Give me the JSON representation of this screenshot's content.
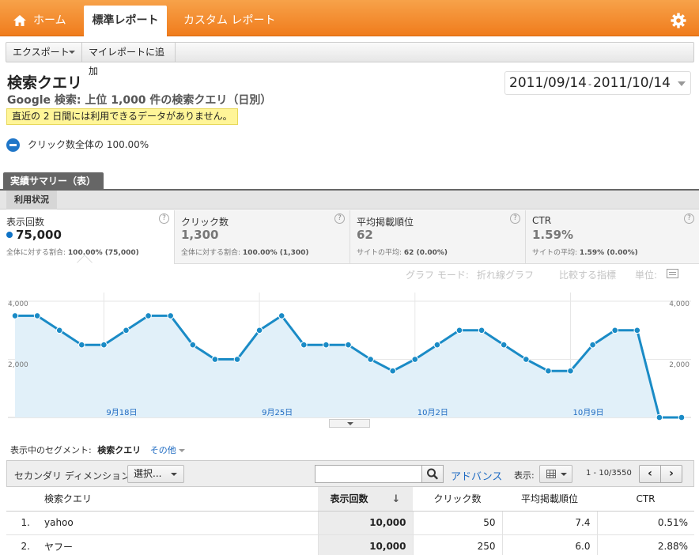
{
  "nav": {
    "home_label": "ホーム",
    "std_label": "標準レポート",
    "custom_label": "カスタム レポート",
    "settings_icon": "gear-icon"
  },
  "toolbar": {
    "export_label": "エクスポート",
    "add_label": "マイレポートに追加"
  },
  "report": {
    "title": "検索クエリ",
    "subtitle": "Google 検索: 上位 1,000 件の検索クエリ（日別）",
    "notice": "直近の 2 日間には利用できるデータがありません。",
    "date_start": "2011/09/14",
    "date_sep": "-",
    "date_end": "2011/10/14",
    "segment_share": "クリック数全体の 100.00%"
  },
  "summary": {
    "tab_label": "実績サマリー（表）",
    "subtab_label": "利用状況"
  },
  "metrics": [
    {
      "name": "表示回数",
      "value": "75,000",
      "foot_label": "全体に対する割合:",
      "foot_value": "100.00% (75,000)"
    },
    {
      "name": "クリック数",
      "value": "1,300",
      "foot_label": "全体に対する割合:",
      "foot_value": "100.00% (1,300)"
    },
    {
      "name": "平均掲載順位",
      "value": "62",
      "foot_label": "サイトの平均:",
      "foot_value": "62 (0.00%)"
    },
    {
      "name": "CTR",
      "value": "1.59%",
      "foot_label": "サイトの平均:",
      "foot_value": "1.59% (0.00%)"
    }
  ],
  "graph_controls": {
    "mode_label": "グラフ モード:",
    "mode_value": "折れ線グラフ",
    "compare_label": "比較する指標",
    "unit_label": "単位:"
  },
  "chart_data": {
    "type": "area",
    "x": [
      "9/14",
      "9/15",
      "9/16",
      "9/17",
      "9/18",
      "9/19",
      "9/20",
      "9/21",
      "9/22",
      "9/23",
      "9/24",
      "9/25",
      "9/26",
      "9/27",
      "9/28",
      "9/29",
      "9/30",
      "10/1",
      "10/2",
      "10/3",
      "10/4",
      "10/5",
      "10/6",
      "10/7",
      "10/8",
      "10/9",
      "10/10",
      "10/11",
      "10/12",
      "10/13",
      "10/14"
    ],
    "series": [
      {
        "values": [
          3500,
          3500,
          3000,
          2500,
          2500,
          3000,
          3500,
          3500,
          2500,
          2000,
          2000,
          3000,
          3500,
          2500,
          2500,
          2500,
          2000,
          1600,
          2000,
          2500,
          3000,
          3000,
          2500,
          2000,
          1600,
          1600,
          2500,
          3000,
          3000,
          0,
          0
        ]
      }
    ],
    "ylim": [
      0,
      4000
    ],
    "yticks": [
      "4,000",
      "2,000"
    ],
    "xtick_labels": [
      "9月18日",
      "9月25日",
      "10月2日",
      "10月9日"
    ],
    "xtick_index": [
      4,
      11,
      18,
      25
    ],
    "grid": true,
    "line_color": "#1a8bc6",
    "fill_color": "#e1f0f9"
  },
  "segment": {
    "label": "表示中のセグメント:",
    "current": "検索クエリ",
    "other": "その他"
  },
  "table_controls": {
    "secondary_label": "セカンダリ ディメンション:",
    "select_label": "選択...",
    "search_placeholder": "",
    "advanced_label": "アドバンス",
    "view_label": "表示:",
    "pager": "1 - 10/3550",
    "prev": "‹",
    "next": "›"
  },
  "table": {
    "headers": [
      "検索クエリ",
      "表示回数",
      "クリック数",
      "平均掲載順位",
      "CTR"
    ],
    "rows": [
      {
        "rank": "1.",
        "query": "yahoo",
        "impressions": "10,000",
        "clicks": "50",
        "position": "7.4",
        "ctr": "0.51%"
      },
      {
        "rank": "2.",
        "query": "ヤフー",
        "impressions": "10,000",
        "clicks": "250",
        "position": "6.0",
        "ctr": "2.88%"
      }
    ]
  }
}
